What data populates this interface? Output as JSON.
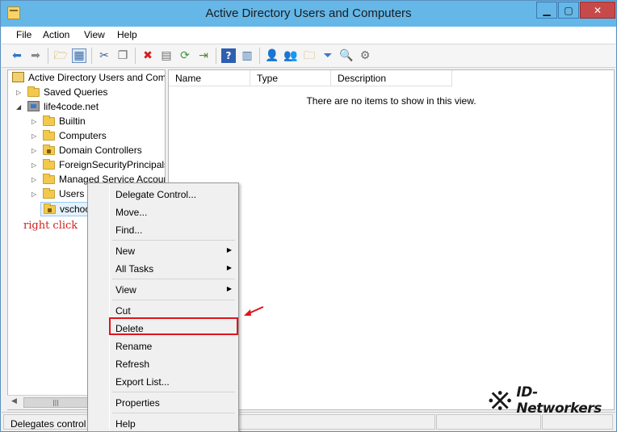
{
  "window": {
    "title": "Active Directory Users and Computers"
  },
  "menubar": {
    "items": [
      "File",
      "Action",
      "View",
      "Help"
    ]
  },
  "toolbar": {
    "icons": [
      "back-arrow-icon",
      "forward-arrow-icon",
      "up-folder-icon",
      "show-console-tree-icon",
      "cut-icon",
      "copy-icon",
      "delete-icon",
      "properties-icon",
      "refresh-icon",
      "export-list-icon",
      "help-icon",
      "action-pane-icon",
      "new-user-icon",
      "new-group-icon",
      "new-ou-icon",
      "filter-icon",
      "find-icon",
      "add-to-group-icon"
    ]
  },
  "tree": {
    "root": "Active Directory Users and Com",
    "saved_queries": "Saved Queries",
    "domain": "life4code.net",
    "children": [
      "Builtin",
      "Computers",
      "Domain Controllers",
      "ForeignSecurityPrincipals",
      "Managed Service Accour",
      "Users",
      "vschoo"
    ]
  },
  "list": {
    "columns": [
      "Name",
      "Type",
      "Description"
    ],
    "empty_message": "There are no items to show in this view."
  },
  "status": {
    "text": "Delegates control o"
  },
  "context_menu": {
    "items": {
      "delegate": "Delegate Control...",
      "move": "Move...",
      "find": "Find...",
      "new": "New",
      "all_tasks": "All Tasks",
      "view": "View",
      "cut": "Cut",
      "delete": "Delete",
      "rename": "Rename",
      "refresh": "Refresh",
      "export": "Export List...",
      "properties": "Properties",
      "help": "Help"
    },
    "submenu_glyph": "▶"
  },
  "annotation": {
    "text": "right click",
    "color": "#d42020"
  },
  "watermark": {
    "text": "ID-Networkers"
  },
  "colors": {
    "titlebar": "#65b7e8",
    "close_button": "#c74a4a",
    "highlight": "#e0141c"
  }
}
